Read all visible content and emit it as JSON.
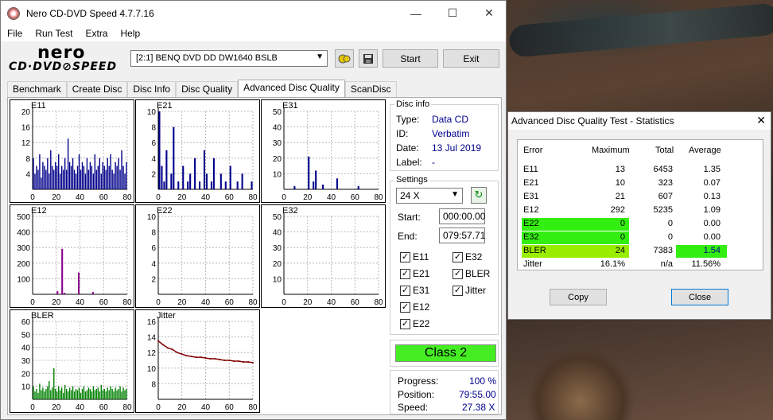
{
  "window": {
    "title": "Nero CD-DVD Speed 4.7.7.16"
  },
  "menu": [
    "File",
    "Run Test",
    "Extra",
    "Help"
  ],
  "logo": {
    "line1": "nero",
    "line2": "CD·DVD⊘SPEED"
  },
  "drive": {
    "selected": "[2:1]  BENQ DVD DD DW1640 BSLB"
  },
  "toolbar": {
    "start_label": "Start",
    "exit_label": "Exit"
  },
  "tabs": [
    "Benchmark",
    "Create Disc",
    "Disc Info",
    "Disc Quality",
    "Advanced Disc Quality",
    "ScanDisc"
  ],
  "active_tab": "Advanced Disc Quality",
  "disc_info": {
    "header": "Disc info",
    "type_label": "Type:",
    "type": "Data CD",
    "id_label": "ID:",
    "id": "Verbatim",
    "date_label": "Date:",
    "date": "13 Jul 2019",
    "label_label": "Label:",
    "label": "-"
  },
  "settings": {
    "header": "Settings",
    "speed": "24 X",
    "start_label": "Start:",
    "start": "000:00.00",
    "end_label": "End:",
    "end": "079:57.71",
    "checkboxes": [
      "E11",
      "E32",
      "E21",
      "BLER",
      "E31",
      "Jitter",
      "E12",
      "E22"
    ]
  },
  "class_label": "Class 2",
  "progress": {
    "progress_label": "Progress:",
    "progress": "100 %",
    "position_label": "Position:",
    "position": "79:55.00",
    "speed_label": "Speed:",
    "speed": "27.38 X"
  },
  "chart_data": [
    {
      "type": "bar",
      "title": "E11",
      "x_ticks": [
        "0",
        "20",
        "40",
        "60",
        "80"
      ],
      "y_ticks": [
        "4",
        "8",
        "12",
        "16",
        "20"
      ],
      "xlim": [
        0,
        80
      ],
      "ylim": [
        0,
        20
      ],
      "color": "#00008b",
      "values": [
        8,
        4,
        6,
        5,
        9,
        3,
        7,
        6,
        5,
        8,
        4,
        10,
        6,
        5,
        7,
        6,
        9,
        4,
        6,
        5,
        8,
        5,
        13,
        7,
        6,
        8,
        5,
        4,
        6,
        9,
        5,
        7,
        6,
        4,
        8,
        5,
        7,
        6,
        4,
        9,
        5,
        6,
        8,
        4,
        7,
        6,
        5,
        8,
        6,
        9,
        5,
        4,
        7,
        6,
        8,
        5,
        10,
        6,
        4,
        7
      ]
    },
    {
      "type": "bar",
      "title": "E21",
      "x_ticks": [
        "0",
        "20",
        "40",
        "60",
        "80"
      ],
      "y_ticks": [
        "2",
        "4",
        "6",
        "8",
        "10"
      ],
      "xlim": [
        0,
        80
      ],
      "ylim": [
        0,
        10
      ],
      "color": "#00008b",
      "values": [
        10,
        3,
        1,
        5,
        0,
        2,
        8,
        0,
        1,
        0,
        3,
        0,
        1,
        2,
        0,
        4,
        0,
        1,
        0,
        5,
        2,
        0,
        1,
        4,
        0,
        0,
        2,
        0,
        1,
        0,
        3,
        0,
        0,
        1,
        0,
        2,
        0,
        0,
        0,
        1
      ]
    },
    {
      "type": "bar",
      "title": "E31",
      "x_ticks": [
        "0",
        "20",
        "40",
        "60",
        "80"
      ],
      "y_ticks": [
        "10",
        "20",
        "30",
        "40",
        "50"
      ],
      "xlim": [
        0,
        80
      ],
      "ylim": [
        0,
        50
      ],
      "color": "#00008b",
      "values": [
        0,
        0,
        0,
        0,
        2,
        0,
        0,
        0,
        0,
        0,
        21,
        0,
        5,
        12,
        0,
        0,
        3,
        0,
        0,
        0,
        0,
        0,
        7,
        0,
        0,
        0,
        0,
        0,
        0,
        0,
        0,
        2,
        0,
        0,
        0,
        0,
        0,
        0,
        0,
        0
      ]
    },
    {
      "type": "bar",
      "title": "E12",
      "x_ticks": [
        "0",
        "20",
        "40",
        "60",
        "80"
      ],
      "y_ticks": [
        "100",
        "200",
        "300",
        "400",
        "500"
      ],
      "xlim": [
        0,
        80
      ],
      "ylim": [
        0,
        500
      ],
      "color": "#8b008b",
      "values": [
        0,
        0,
        0,
        0,
        0,
        0,
        0,
        0,
        0,
        0,
        20,
        0,
        292,
        10,
        0,
        0,
        0,
        0,
        0,
        140,
        0,
        0,
        0,
        0,
        0,
        15,
        0,
        0,
        0,
        0,
        0,
        0,
        0,
        0,
        0,
        0,
        0,
        0,
        0,
        0
      ]
    },
    {
      "type": "bar",
      "title": "E22",
      "x_ticks": [
        "0",
        "20",
        "40",
        "60",
        "80"
      ],
      "y_ticks": [
        "2",
        "4",
        "6",
        "8",
        "10"
      ],
      "xlim": [
        0,
        80
      ],
      "ylim": [
        0,
        10
      ],
      "values": []
    },
    {
      "type": "bar",
      "title": "E32",
      "x_ticks": [
        "0",
        "20",
        "40",
        "60",
        "80"
      ],
      "y_ticks": [
        "10",
        "20",
        "30",
        "40",
        "50"
      ],
      "xlim": [
        0,
        80
      ],
      "ylim": [
        0,
        50
      ],
      "values": []
    },
    {
      "type": "bar",
      "title": "BLER",
      "x_ticks": [
        "0",
        "20",
        "40",
        "60",
        "80"
      ],
      "y_ticks": [
        "10",
        "20",
        "30",
        "40",
        "50",
        "60"
      ],
      "xlim": [
        0,
        80
      ],
      "ylim": [
        0,
        60
      ],
      "color": "#008000",
      "values": [
        10,
        6,
        8,
        5,
        12,
        7,
        9,
        6,
        8,
        10,
        14,
        7,
        9,
        24,
        8,
        6,
        10,
        7,
        9,
        5,
        11,
        8,
        6,
        9,
        7,
        10,
        6,
        8,
        7,
        9,
        5,
        8,
        10,
        6,
        7,
        9,
        8,
        6,
        10,
        7,
        8,
        9,
        6,
        11,
        7,
        8,
        6,
        9,
        7,
        10,
        8,
        6,
        9,
        7,
        8,
        10,
        6,
        9,
        7,
        8
      ]
    },
    {
      "type": "line",
      "title": "Jitter",
      "x_ticks": [
        "0",
        "20",
        "40",
        "60",
        "80"
      ],
      "y_ticks": [
        "8",
        "10",
        "12",
        "14",
        "16"
      ],
      "xlim": [
        0,
        80
      ],
      "ylim": [
        6,
        16
      ],
      "color": "#800000",
      "x": [
        0,
        4,
        8,
        12,
        16,
        20,
        24,
        28,
        32,
        36,
        40,
        44,
        48,
        52,
        56,
        60,
        64,
        68,
        72,
        76,
        80
      ],
      "values": [
        13.5,
        13.0,
        12.6,
        12.4,
        12.0,
        11.8,
        11.6,
        11.5,
        11.4,
        11.4,
        11.3,
        11.2,
        11.2,
        11.1,
        11.0,
        11.0,
        10.9,
        10.9,
        10.8,
        10.8,
        10.7
      ]
    }
  ],
  "stats": {
    "title": "Advanced Disc Quality Test - Statistics",
    "headers": [
      "Error",
      "Maximum",
      "Total",
      "Average"
    ],
    "rows": [
      {
        "name": "E11",
        "max": "13",
        "total": "6453",
        "avg": "1.35"
      },
      {
        "name": "E21",
        "max": "10",
        "total": "323",
        "avg": "0.07"
      },
      {
        "name": "E31",
        "max": "21",
        "total": "607",
        "avg": "0.13"
      },
      {
        "name": "E12",
        "max": "292",
        "total": "5235",
        "avg": "1.09"
      },
      {
        "name": "E22",
        "max": "0",
        "total": "0",
        "avg": "0.00"
      },
      {
        "name": "E32",
        "max": "0",
        "total": "0",
        "avg": "0.00"
      },
      {
        "name": "BLER",
        "max": "24",
        "total": "7383",
        "avg": "1.54"
      },
      {
        "name": "Jitter",
        "max": "16.1%",
        "total": "n/a",
        "avg": "11.56%"
      }
    ],
    "copy_label": "Copy",
    "close_label": "Close",
    "highlight_green": "#33ee11",
    "highlight_lime": "#99ee00"
  }
}
